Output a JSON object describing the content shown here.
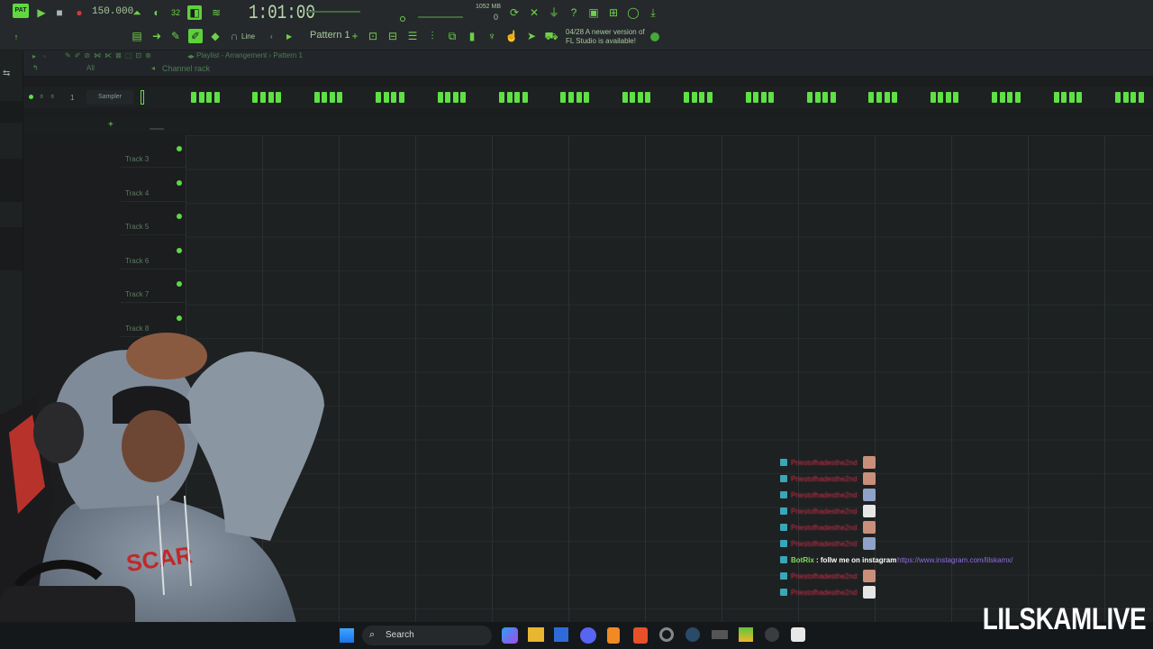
{
  "transport": {
    "tempo": "150.000",
    "song_position": "1:01:00",
    "memory": "1052 MB",
    "memory_sub": "0",
    "pattern_name": "Pattern 1",
    "snap_mode": "Line",
    "notice_line1": "04/28 A newer version of",
    "notice_line2": "FL Studio is available!"
  },
  "browser": {
    "filter_label": "All"
  },
  "playlist": {
    "breadcrumb_1": "Playlist",
    "breadcrumb_sep": "-",
    "breadcrumb_2": "Arrangement",
    "breadcrumb_arrow": "›",
    "breadcrumb_3": "Pattern 1",
    "channel_rack_label": "Channel rack",
    "tracks": [
      "Track 3",
      "Track 4",
      "Track 5",
      "Track 6",
      "Track 7",
      "Track 8"
    ]
  },
  "channel_rack": {
    "channel_number": "1",
    "channel_name": "Sampler",
    "add_symbol": "+"
  },
  "chat": {
    "blurred_name": "Priestofhadesthe2nd",
    "bot_name": "BotRix",
    "bot_message": ": follw me on instagram",
    "bot_link": "https://www.instagram.com/lilskamx/"
  },
  "taskbar": {
    "search_label": "Search"
  },
  "overlay": {
    "watermark": "LILSKAMLIVE"
  },
  "colors": {
    "accent_green": "#5fe045",
    "chat_name_red": "#d0304a",
    "link_purple": "#8f6dea",
    "badge_teal": "#3aa6b8"
  }
}
